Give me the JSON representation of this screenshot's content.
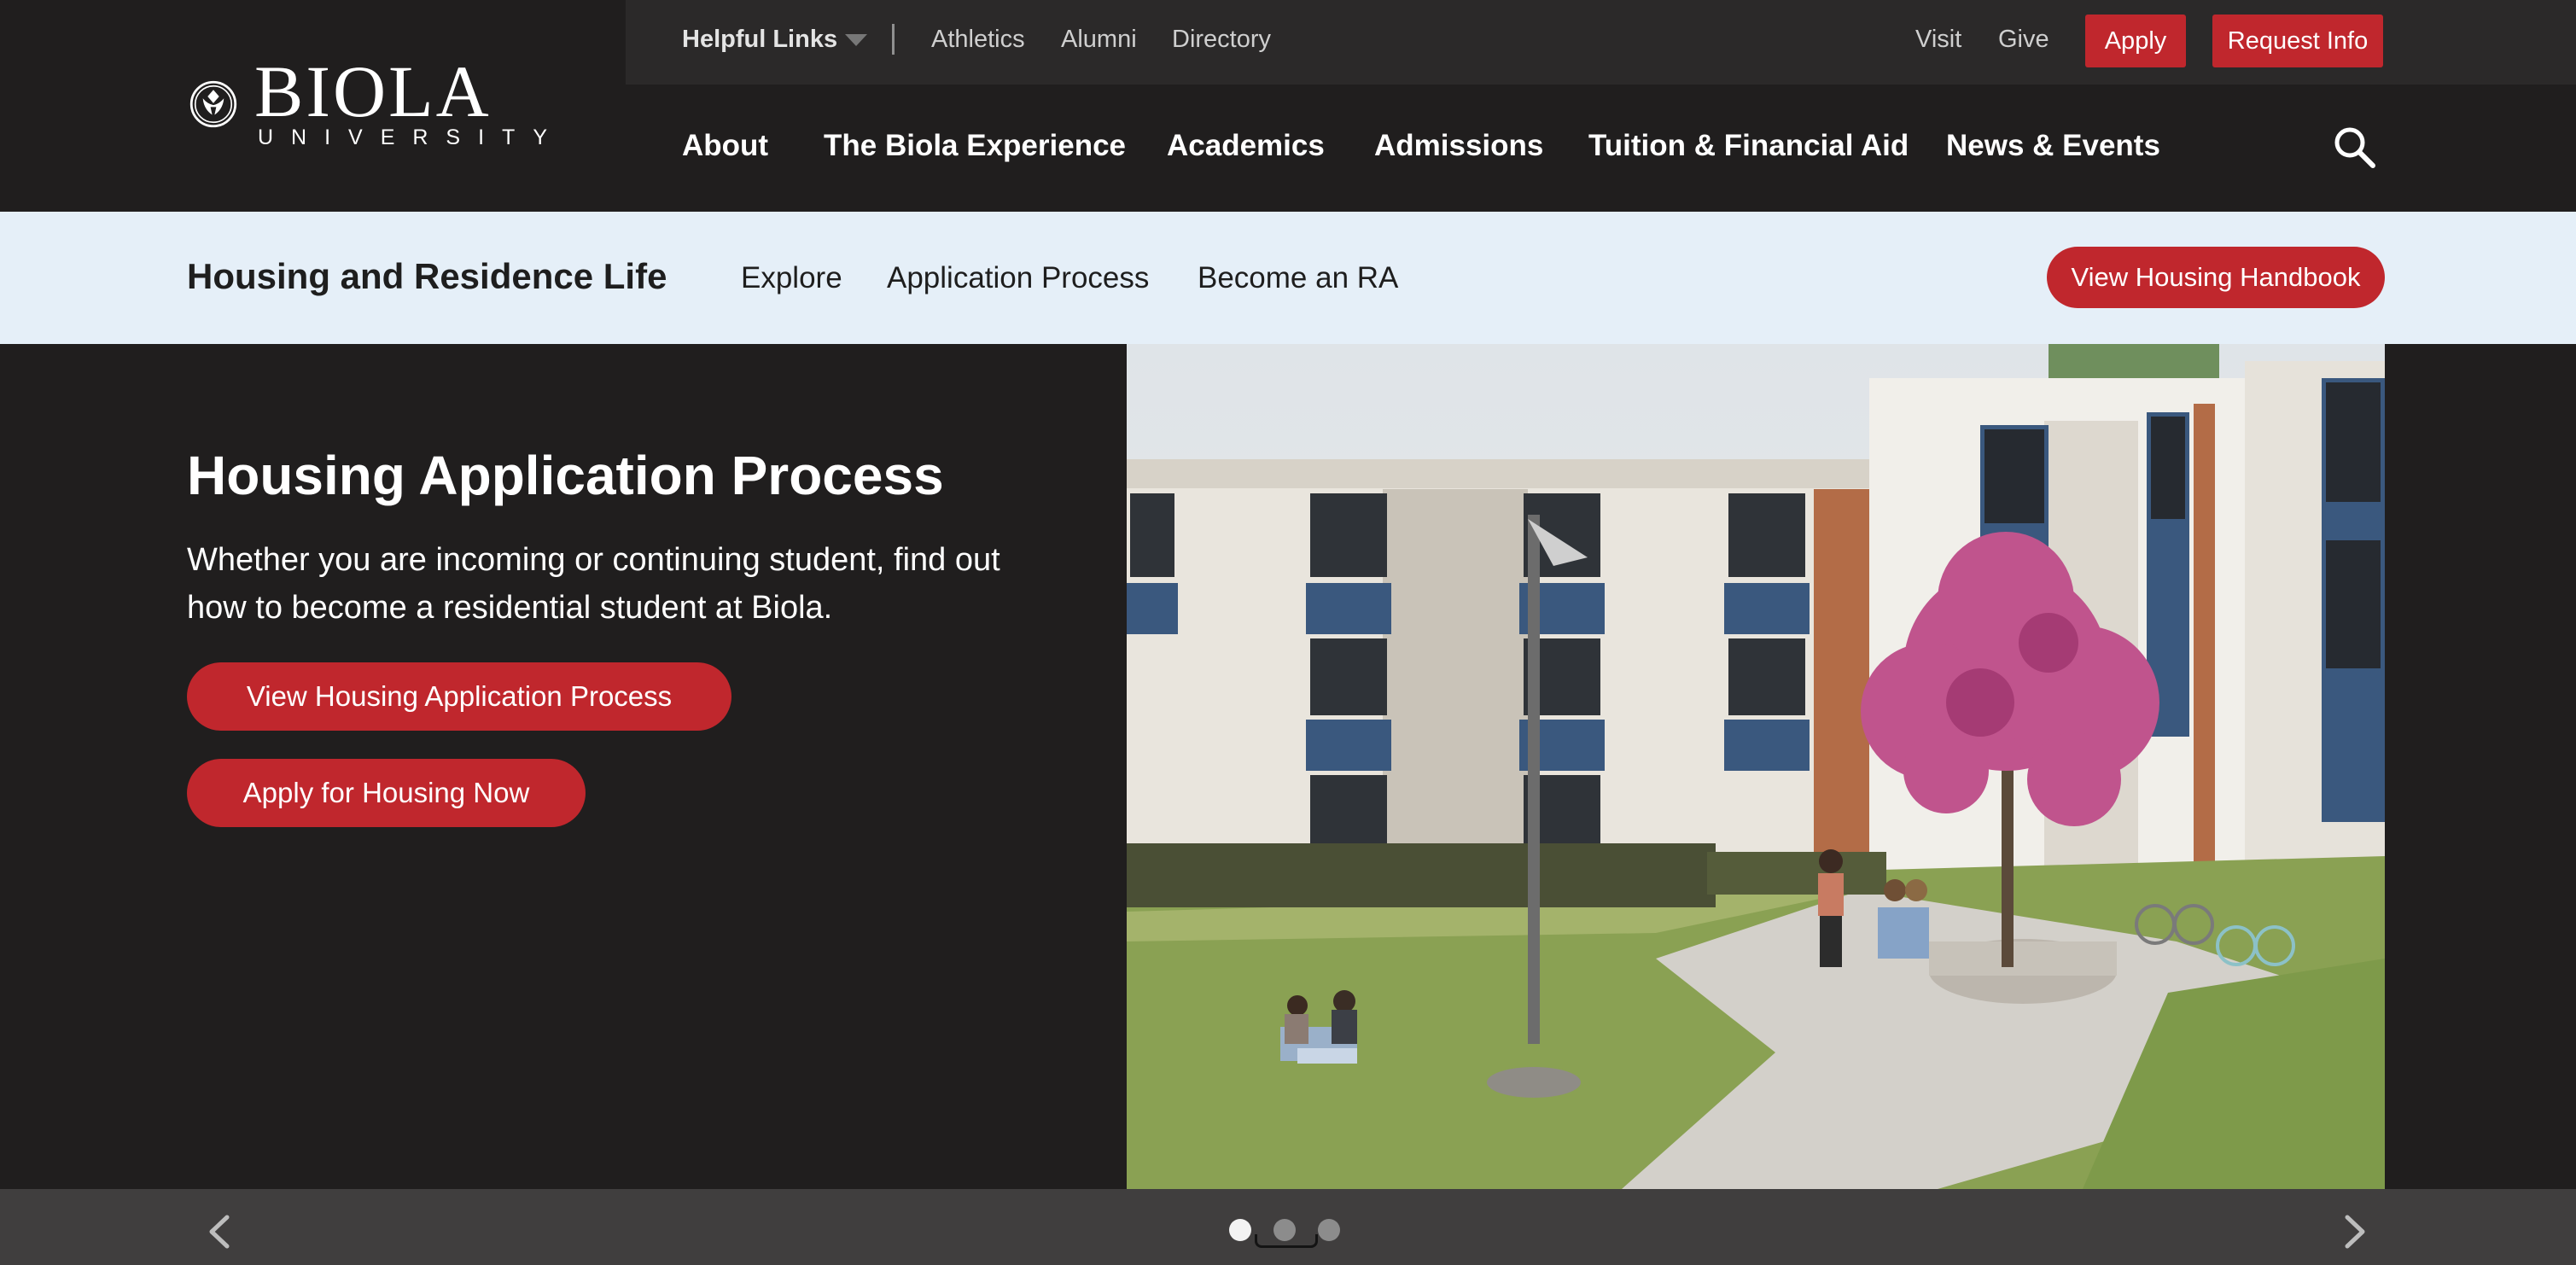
{
  "brand": {
    "name": "BIOLA",
    "subtitle": "UNIVERSITY"
  },
  "utility_nav": {
    "helpful_links": "Helpful Links",
    "links": [
      "Athletics",
      "Alumni",
      "Directory"
    ],
    "right_links": [
      "Visit",
      "Give"
    ],
    "apply": "Apply",
    "request_info": "Request Info"
  },
  "main_nav": {
    "items": [
      "About",
      "The Biola Experience",
      "Academics",
      "Admissions",
      "Tuition & Financial Aid",
      "News & Events"
    ]
  },
  "section_nav": {
    "title": "Housing and Residence Life",
    "links": [
      "Explore",
      "Application Process",
      "Become an RA"
    ],
    "handbook_button": "View Housing Handbook"
  },
  "hero": {
    "title": "Housing Application Process",
    "body": "Whether you are incoming or continuing student, find out how to become a residential student at Biola.",
    "primary_button": "View Housing Application Process",
    "secondary_button": "Apply for Housing Now"
  },
  "carousel": {
    "slide_count": 3,
    "active_index": 0
  },
  "colors": {
    "header_bg": "#201e1e",
    "utility_bg": "#2b2929",
    "subnav_bg": "#e5eff8",
    "accent_red": "#c0272d",
    "carousel_bar": "#403e3e"
  }
}
